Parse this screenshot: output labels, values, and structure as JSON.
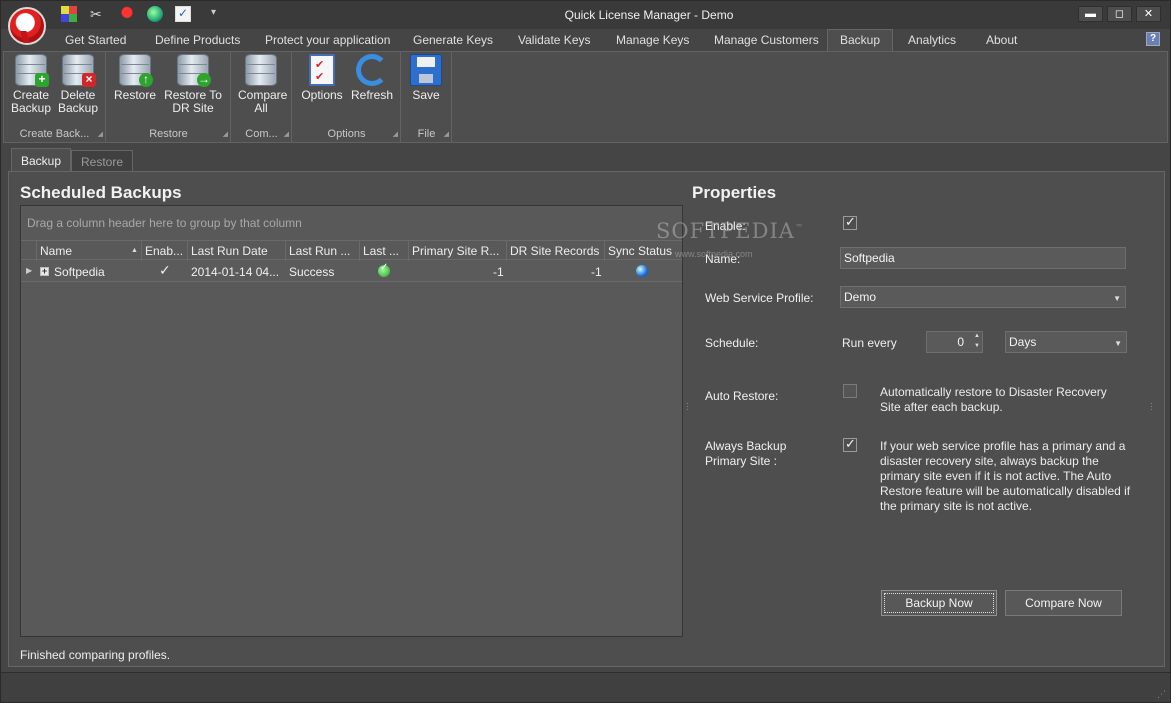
{
  "window": {
    "title": "Quick License Manager - Demo",
    "min_glyph": "▬",
    "max_glyph": "◻",
    "close_glyph": "✕"
  },
  "quick_access": {
    "dropdown_glyph": "▾"
  },
  "ribbon_tabs": [
    "Get Started",
    "Define Products",
    "Protect your application",
    "Generate Keys",
    "Validate Keys",
    "Manage Keys",
    "Manage Customers",
    "Backup",
    "Analytics",
    "About"
  ],
  "active_ribbon_tab": "Backup",
  "help_glyph": "?",
  "ribbon": {
    "groups": {
      "create_backup": "Create Back...",
      "restore": "Restore",
      "compare": "Com...",
      "options": "Options",
      "file": "File"
    },
    "buttons": {
      "create_backup": [
        "Create",
        "Backup"
      ],
      "delete_backup": [
        "Delete",
        "Backup"
      ],
      "restore": [
        "Restore"
      ],
      "restore_dr": [
        "Restore To",
        "DR Site"
      ],
      "compare_all": [
        "Compare",
        "All"
      ],
      "options": [
        "Options"
      ],
      "refresh": [
        "Refresh"
      ],
      "save": [
        "Save"
      ]
    }
  },
  "content_tabs": {
    "backup": "Backup",
    "restore": "Restore"
  },
  "scheduled": {
    "title": "Scheduled Backups",
    "group_hint": "Drag a column header here to group by that column",
    "columns": [
      "Name",
      "Enab...",
      "Last Run Date",
      "Last Run ...",
      "Last ...",
      "Primary Site R...",
      "DR Site Records",
      "Sync Status"
    ],
    "rows": [
      {
        "name": "Softpedia",
        "enabled": true,
        "last_run_date": "2014-01-14 04...",
        "last_run_result": "Success",
        "last_status_icon": "ok-check-icon",
        "primary_site_records": "-1",
        "dr_site_records": "-1",
        "sync_status_icon": "blue-orb-icon"
      }
    ]
  },
  "status_message": "Finished comparing profiles.",
  "properties": {
    "title": "Properties",
    "enable_label": "Enable:",
    "enable_checked": true,
    "name_label": "Name:",
    "name_value": "Softpedia",
    "profile_label": "Web Service Profile:",
    "profile_value": "Demo",
    "schedule_label": "Schedule:",
    "run_every_label": "Run every",
    "run_every_value": "0",
    "unit_value": "Days",
    "auto_restore_label": "Auto Restore:",
    "auto_restore_checked": false,
    "auto_restore_desc": "Automatically restore to Disaster Recovery Site after each backup.",
    "always_backup_label": "Always Backup Primary Site :",
    "always_backup_checked": true,
    "always_backup_desc": "If your web service profile has a primary and a disaster recovery site, always backup the primary site even if it is not active. The Auto Restore feature will be automatically disabled if the primary site is not active.",
    "backup_now": "Backup Now",
    "compare_now": "Compare Now"
  },
  "watermark": {
    "brand": "SOFTPEDIA",
    "mark": "™",
    "url": "www.softpedia.com"
  },
  "colors": {
    "background": "#454545",
    "panel": "#4e4e4e",
    "grid": "#595959",
    "accent_blue": "#1b6fe0",
    "ok_green": "#2a9a2a"
  }
}
